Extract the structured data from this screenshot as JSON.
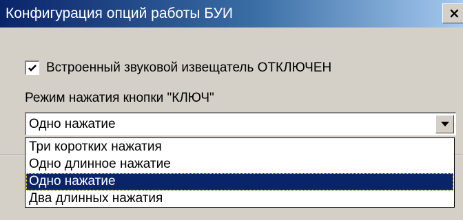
{
  "window": {
    "title": "Конфигурация опций работы БУИ",
    "close_label": "×"
  },
  "options": {
    "buzzer_checkbox": {
      "label": "Встроенный звуковой извещатель ОТКЛЮЧЕН",
      "checked": true
    },
    "key_mode": {
      "label": "Режим нажатия кнопки \"КЛЮЧ\"",
      "selected_value": "Одно нажатие",
      "dropdown_open": true,
      "items": [
        {
          "label": "Три коротких нажатия",
          "selected": false
        },
        {
          "label": "Одно длинное нажатие",
          "selected": false
        },
        {
          "label": "Одно нажатие",
          "selected": true
        },
        {
          "label": "Два длинных нажатия",
          "selected": false
        }
      ]
    }
  },
  "icons": {
    "checkbox_mark": "check-icon",
    "dropdown_arrow": "chevron-down-icon",
    "close": "close-icon"
  },
  "colors": {
    "title_gradient_start": "#0a246a",
    "title_gradient_end": "#a6caf0",
    "window_background": "#d4d0c8",
    "selection_background": "#0a246a",
    "selection_text": "#ffffff"
  }
}
